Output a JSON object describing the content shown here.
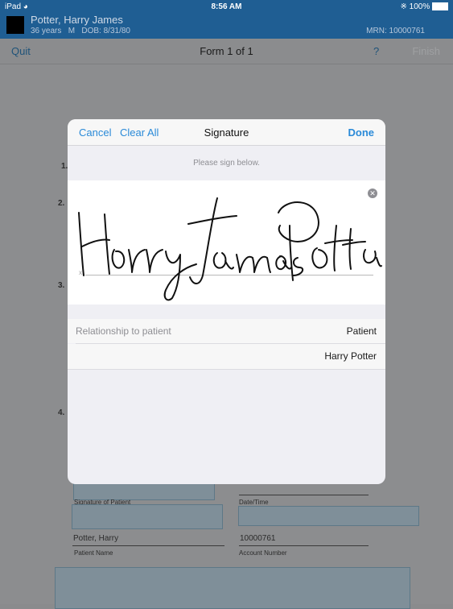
{
  "status": {
    "device": "iPad",
    "time": "8:56 AM",
    "battery": "100%"
  },
  "patient": {
    "name": "Potter, Harry James",
    "age": "36 years",
    "sex": "M",
    "dob": "DOB: 8/31/80",
    "mrn": "MRN: 10000761"
  },
  "toolbar": {
    "quit": "Quit",
    "title": "Form 1 of 1",
    "help": "?",
    "finish": "Finish"
  },
  "form": {
    "section_numbers": [
      "1.",
      "2.",
      "3.",
      "4."
    ],
    "signature_of_patient_label": "Signature of Patient",
    "date_time_label": "Date/Time",
    "patient_name_value": "Potter, Harry",
    "patient_name_label": "Patient Name",
    "account_number_value": "10000761",
    "account_number_label": "Account Number"
  },
  "modal": {
    "cancel": "Cancel",
    "clear_all": "Clear All",
    "title": "Signature",
    "done": "Done",
    "hint": "Please sign below.",
    "x_mark": "x",
    "relationship_label": "Relationship to patient",
    "relationship_value": "Patient",
    "signer_name": "Harry Potter"
  },
  "icons": {
    "wifi": "wifi-icon",
    "bluetooth": "bluetooth-icon",
    "battery": "battery-icon",
    "clear_signature": "clear-circle-icon"
  }
}
